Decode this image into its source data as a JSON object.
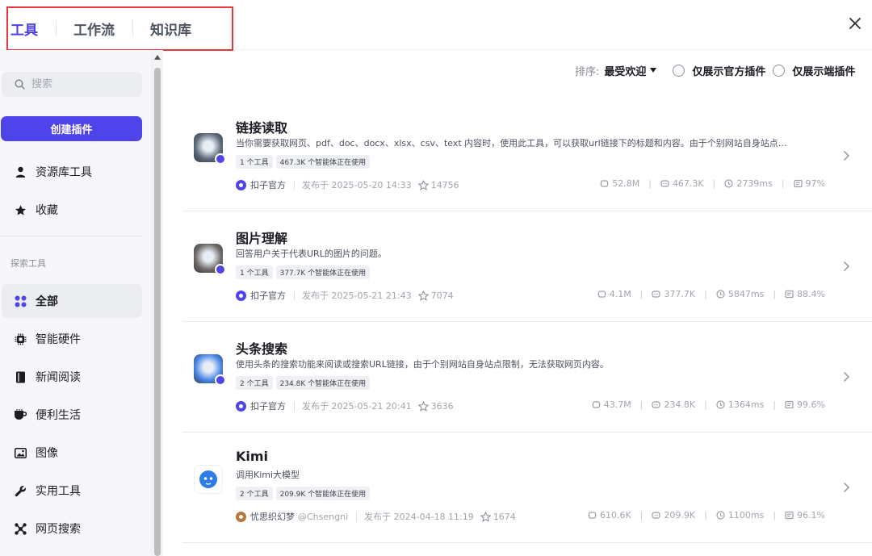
{
  "header": {
    "tabs": [
      {
        "label": "工具",
        "active": true
      },
      {
        "label": "工作流",
        "active": false
      },
      {
        "label": "知识库",
        "active": false
      }
    ],
    "close_icon": "close-icon"
  },
  "sidebar": {
    "search_placeholder": "搜索",
    "create_button": "创建插件",
    "top_items": [
      {
        "label": "资源库工具",
        "icon": "person-icon"
      },
      {
        "label": "收藏",
        "icon": "star-icon"
      }
    ],
    "section_title": "探索工具",
    "categories": [
      {
        "label": "全部",
        "icon": "grid-icon",
        "active": true
      },
      {
        "label": "智能硬件",
        "icon": "chip-icon"
      },
      {
        "label": "新闻阅读",
        "icon": "book-icon"
      },
      {
        "label": "便利生活",
        "icon": "cup-icon"
      },
      {
        "label": "图像",
        "icon": "image-icon"
      },
      {
        "label": "实用工具",
        "icon": "wrench-icon"
      },
      {
        "label": "网页搜索",
        "icon": "network-icon"
      }
    ]
  },
  "toolbar": {
    "sort_label": "排序:",
    "sort_value": "最受欢迎",
    "filter_official": "仅展示官方插件",
    "filter_client": "仅展示端插件"
  },
  "plugins": [
    {
      "name": "链接读取",
      "description": "当你需要获取网页、pdf、doc、docx、xlsx、csv、text 内容时，使用此工具，可以获取url链接下的标题和内容。由于个别网站自身站点…",
      "tools": "1 个工具",
      "users": "467.3K 个智能体正在使用",
      "author": "扣子官方",
      "handle": "",
      "published": "发布于 2025-05-20 14:33",
      "stars": "14756",
      "calls": "52.8M",
      "bots": "467.3K",
      "latency": "2739ms",
      "success": "97%",
      "thumb_color": "#5c6a78"
    },
    {
      "name": "图片理解",
      "description": "回答用户关于代表URL的图片的问题。",
      "tools": "1 个工具",
      "users": "377.7K 个智能体正在使用",
      "author": "扣子官方",
      "handle": "",
      "published": "发布于 2025-05-21 21:43",
      "stars": "7074",
      "calls": "4.1M",
      "bots": "377.7K",
      "latency": "5847ms",
      "success": "88.4%",
      "thumb_color": "#6f6a66"
    },
    {
      "name": "头条搜索",
      "description": "使用头条的搜索功能来阅读或搜索URL链接，由于个别网站自身站点限制，无法获取网页内容。",
      "tools": "2 个工具",
      "users": "234.8K 个智能体正在使用",
      "author": "扣子官方",
      "handle": "",
      "published": "发布于 2025-05-21 20:41",
      "stars": "3636",
      "calls": "43.7M",
      "bots": "234.8K",
      "latency": "1364ms",
      "success": "99.6%",
      "thumb_color": "#4a86e8"
    },
    {
      "name": "Kimi",
      "description": "调用Kimi大模型",
      "tools": "2 个工具",
      "users": "209.9K 个智能体正在使用",
      "author": "忧思织幻梦",
      "handle": "@Chsengni",
      "published": "发布于 2024-04-18 11:19",
      "stars": "1674",
      "calls": "610.6K",
      "bots": "209.9K",
      "latency": "1100ms",
      "success": "96.1%",
      "thumb_color": "#2f7ce8"
    }
  ],
  "colors": {
    "accent": "#4f44ea",
    "highlight_box": "#e5373d"
  }
}
